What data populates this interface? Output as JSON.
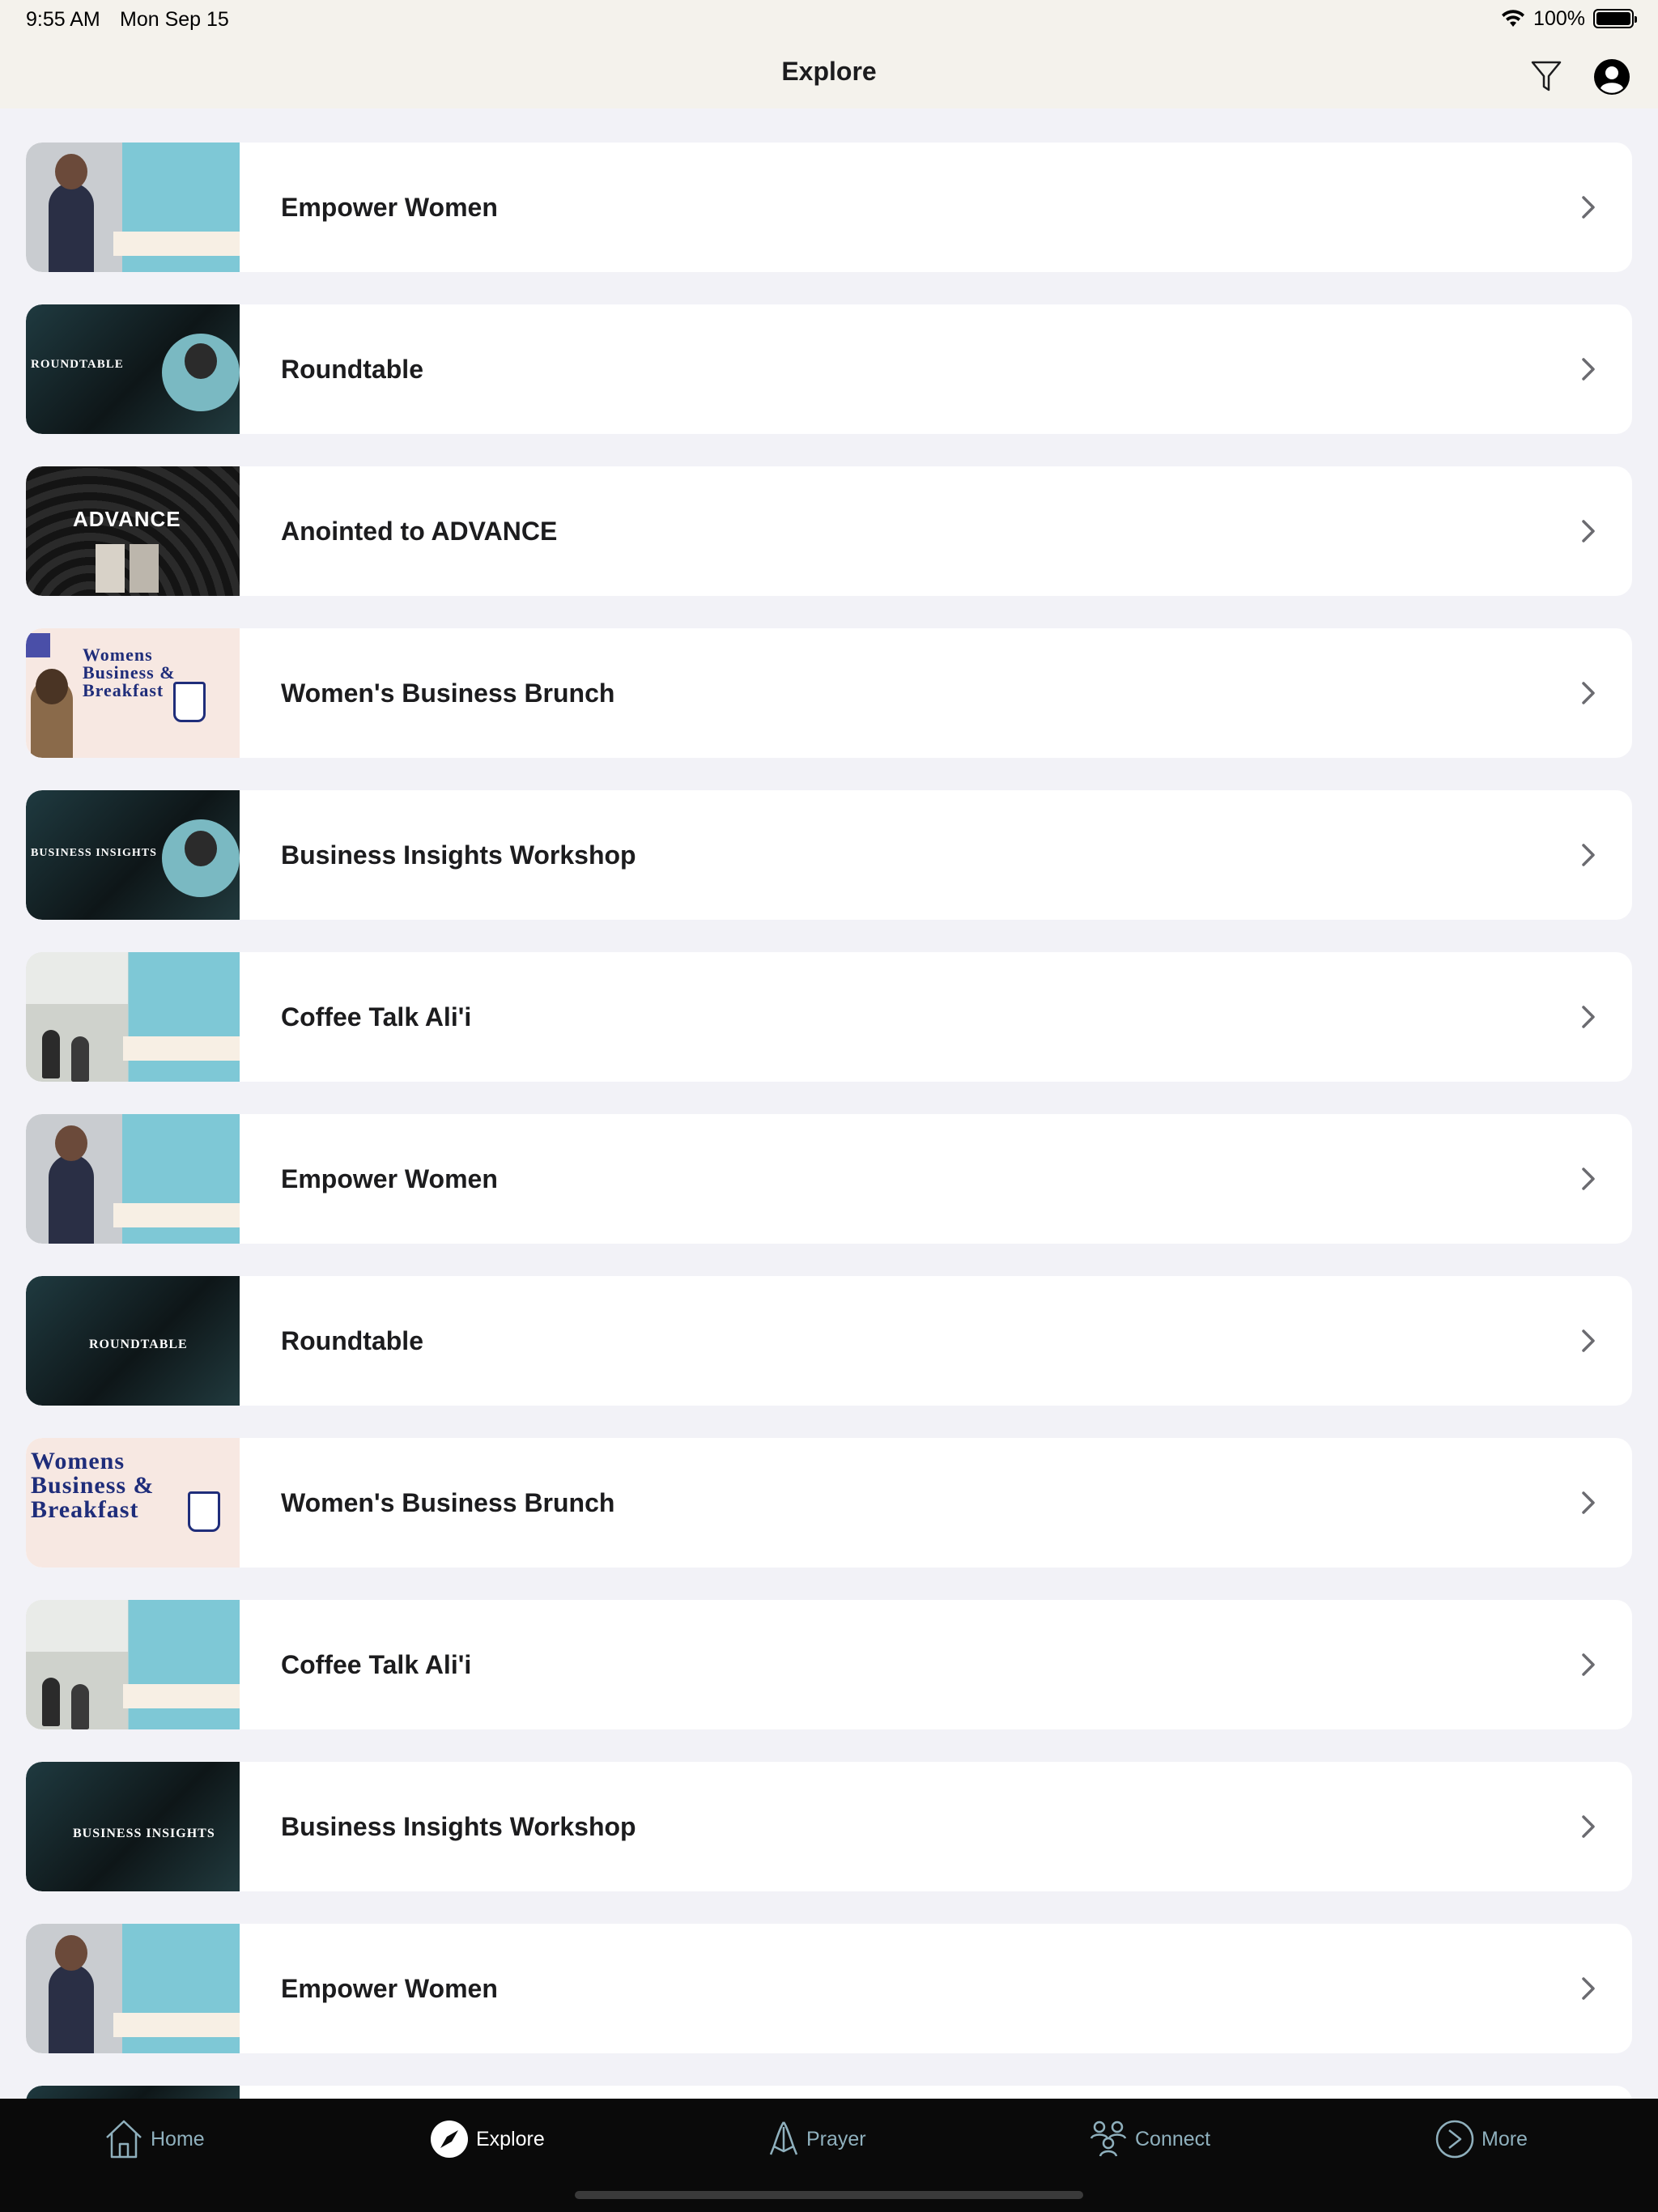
{
  "status_bar": {
    "time": "9:55 AM",
    "date": "Mon Sep 15",
    "battery": "100%"
  },
  "nav": {
    "title": "Explore",
    "filter_icon": "filter-icon",
    "profile_icon": "profile-icon"
  },
  "items": [
    {
      "title": "Empower Women",
      "thumb_text": ""
    },
    {
      "title": "Roundtable",
      "thumb_text": "ROUNDTABLE"
    },
    {
      "title": "Anointed to ADVANCE",
      "thumb_text": "ADVANCE"
    },
    {
      "title": "Women's Business Brunch",
      "thumb_text": "Womens Business & Breakfast"
    },
    {
      "title": "Business Insights Workshop",
      "thumb_text": "BUSINESS INSIGHTS"
    },
    {
      "title": "Coffee Talk Ali'i",
      "thumb_text": ""
    },
    {
      "title": "Empower Women",
      "thumb_text": ""
    },
    {
      "title": "Roundtable",
      "thumb_text": "ROUNDTABLE"
    },
    {
      "title": "Women's Business Brunch",
      "thumb_text": "Womens Business & Breakfast"
    },
    {
      "title": "Coffee Talk Ali'i",
      "thumb_text": ""
    },
    {
      "title": "Business Insights Workshop",
      "thumb_text": "BUSINESS INSIGHTS"
    },
    {
      "title": "Empower Women",
      "thumb_text": ""
    }
  ],
  "tabs": [
    {
      "label": "Home",
      "icon": "home-icon"
    },
    {
      "label": "Explore",
      "icon": "compass-icon"
    },
    {
      "label": "Prayer",
      "icon": "praying-hands-icon"
    },
    {
      "label": "Connect",
      "icon": "people-icon"
    },
    {
      "label": "More",
      "icon": "more-icon"
    }
  ],
  "colors": {
    "nav_background": "#f4f2ec",
    "page_background": "#f2f2f7",
    "tab_bar_background": "#0a0a0a",
    "tab_inactive": "#8fb0bd",
    "tab_active": "#ffffff"
  }
}
